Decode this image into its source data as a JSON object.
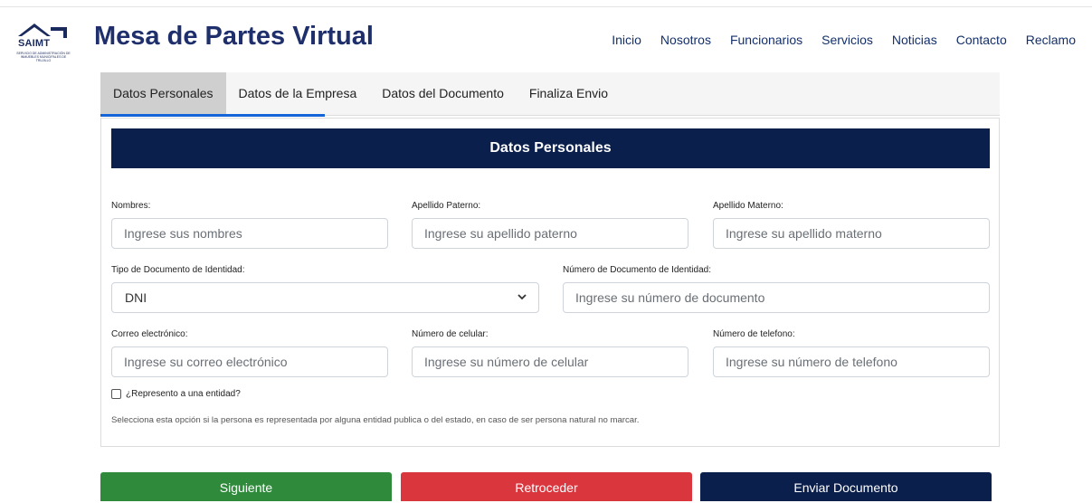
{
  "brand": {
    "logo_text": "SAIMT",
    "logo_subtext": "SERVICIO DE ADMINISTRACIÓN DE INMUEBLES MUNICIPALES DE TRUJILLO",
    "title": "Mesa de Partes Virtual"
  },
  "nav": {
    "items": [
      "Inicio",
      "Nosotros",
      "Funcionarios",
      "Servicios",
      "Noticias",
      "Contacto",
      "Reclamo"
    ]
  },
  "tabs": [
    {
      "label": "Datos Personales",
      "active": true
    },
    {
      "label": "Datos de la Empresa",
      "active": false
    },
    {
      "label": "Datos del Documento",
      "active": false
    },
    {
      "label": "Finaliza Envio",
      "active": false
    }
  ],
  "form": {
    "title": "Datos Personales",
    "nombres": {
      "label": "Nombres:",
      "placeholder": "Ingrese sus nombres"
    },
    "apellido_paterno": {
      "label": "Apellido Paterno:",
      "placeholder": "Ingrese su apellido paterno"
    },
    "apellido_materno": {
      "label": "Apellido Materno:",
      "placeholder": "Ingrese su apellido materno"
    },
    "tipo_documento": {
      "label": "Tipo de Documento de Identidad:",
      "value": "DNI"
    },
    "numero_documento": {
      "label": "Número de Documento de Identidad:",
      "placeholder": "Ingrese su número de documento"
    },
    "correo": {
      "label": "Correo electrónico:",
      "placeholder": "Ingrese su correo electrónico"
    },
    "celular": {
      "label": "Número de celular:",
      "placeholder": "Ingrese su número de celular"
    },
    "telefono": {
      "label": "Número de telefono:",
      "placeholder": "Ingrese su número de telefono"
    },
    "representa": {
      "label": "¿Represento a una entidad?",
      "checked": false
    },
    "help_text": "Selecciona esta opción si la persona es representada por alguna entidad publica o del estado, en caso de ser persona natural no marcar."
  },
  "buttons": {
    "next": "Siguiente",
    "back": "Retroceder",
    "send": "Enviar Documento"
  },
  "colors": {
    "brand_navy": "#0b1f4d",
    "tab_indicator": "#1565d8",
    "next": "#2f8a3c",
    "back": "#d9363e"
  }
}
